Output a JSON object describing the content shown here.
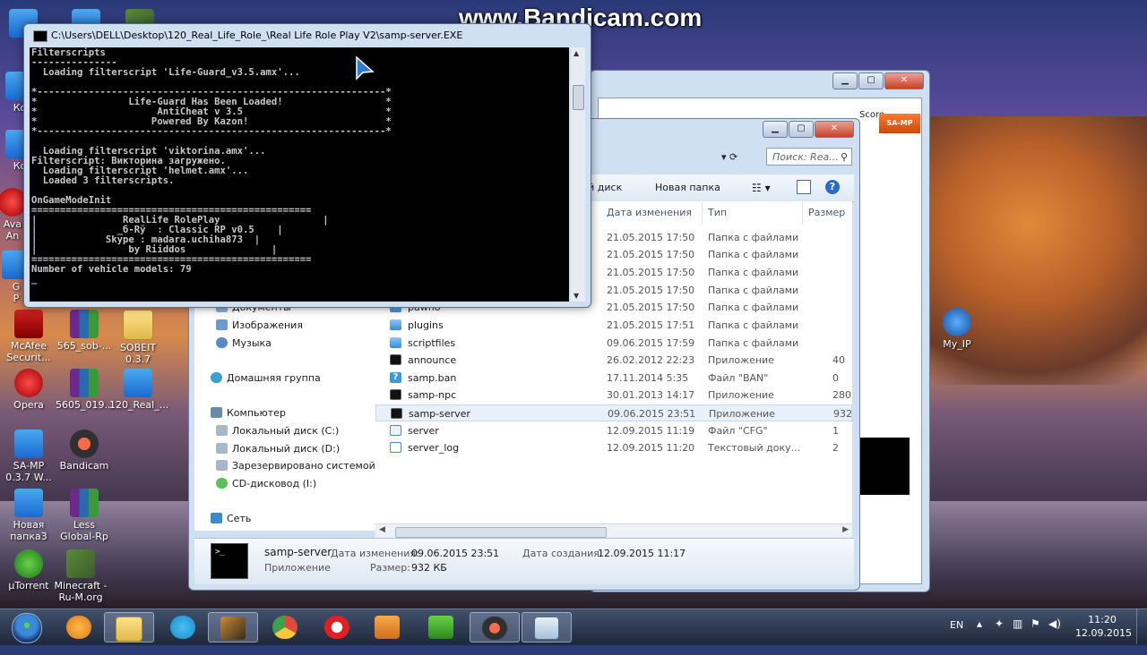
{
  "watermark": "www.Bandicam.com",
  "desktop_icons": [
    {
      "label": "Ко"
    },
    {
      "label": "Ко"
    },
    {
      "label": "Ava\nAn"
    },
    {
      "label": "G\nP"
    },
    {
      "label": "McAfee\nSecurit..."
    },
    {
      "label": "565_sob-..."
    },
    {
      "label": "SOBEIT\n0.3.7"
    },
    {
      "label": "Opera"
    },
    {
      "label": "5605_019..."
    },
    {
      "label": "120_Real_..."
    },
    {
      "label": "SA-MP\n0.3.7 W..."
    },
    {
      "label": "Bandicam"
    },
    {
      "label": "Новая\nпапка3"
    },
    {
      "label": "Less\nGlobal-Rp"
    },
    {
      "label": "µTorrent"
    },
    {
      "label": "Minecraft -\nRu-M.org"
    },
    {
      "label": "My_IP"
    }
  ],
  "console": {
    "title": "C:\\Users\\DELL\\Desktop\\120_Real_Life_Role_\\Real Life Role Play V2\\samp-server.EXE",
    "lines": [
      "Filterscripts",
      "---------------",
      "  Loading filterscript 'Life-Guard_v3.5.amx'...",
      "",
      "*-------------------------------------------------------------*",
      "*                Life-Guard Has Been Loaded!                  *",
      "*                     AntiCheat v 3.5                         *",
      "*                    Powered By Kazon!                        *",
      "*-------------------------------------------------------------*",
      "",
      "  Loading filterscript 'viktorina.amx'...",
      "Filterscript: Викторина загружено.",
      "  Loading filterscript 'helmet.amx'...",
      "  Loaded 3 filterscripts.",
      "",
      "OnGameModeInit",
      "=================================================",
      "|               RealLife RolePlay                  |",
      "|              _б-Rў  : Classic RP v0.5    |",
      "|            Skype : madara.uchiha873  |",
      "|                by Riiddos               |",
      "=================================================",
      "Number of vehicle models: 79",
      "_"
    ]
  },
  "back_window": {
    "score_label": "Score",
    "samp_logo": "SA-MP"
  },
  "explorer": {
    "search_placeholder": "Поиск: Rea...",
    "toolbar": {
      "burn": "ий диск",
      "new_folder": "Новая папка"
    },
    "columns": {
      "date": "Дата изменения",
      "type": "Тип",
      "size": "Размер"
    },
    "nav": [
      {
        "label": "Документы",
        "icon": "documents-icon"
      },
      {
        "label": "Изображения",
        "icon": "images-icon"
      },
      {
        "label": "Музыка",
        "icon": "music-icon"
      },
      {
        "label": "Домашняя группа",
        "icon": "homegroup-icon"
      },
      {
        "label": "Компьютер",
        "icon": "computer-icon"
      },
      {
        "label": "Локальный диск (C:)",
        "icon": "drive-icon"
      },
      {
        "label": "Локальный диск (D:)",
        "icon": "drive-icon"
      },
      {
        "label": "Зарезервировано системой",
        "icon": "drive-icon"
      },
      {
        "label": "CD-дисковод (I:)",
        "icon": "cd-icon"
      },
      {
        "label": "Сеть",
        "icon": "network-icon"
      }
    ],
    "files": [
      {
        "name": "",
        "date": "21.05.2015 17:50",
        "type": "Папка с файлами",
        "size": "",
        "kind": "folder"
      },
      {
        "name": "",
        "date": "21.05.2015 17:50",
        "type": "Папка с файлами",
        "size": "",
        "kind": "folder"
      },
      {
        "name": "",
        "date": "21.05.2015 17:50",
        "type": "Папка с файлами",
        "size": "",
        "kind": "folder"
      },
      {
        "name": "",
        "date": "21.05.2015 17:50",
        "type": "Папка с файлами",
        "size": "",
        "kind": "folder"
      },
      {
        "name": "pawno",
        "date": "21.05.2015 17:50",
        "type": "Папка с файлами",
        "size": "",
        "kind": "folder"
      },
      {
        "name": "plugins",
        "date": "21.05.2015 17:51",
        "type": "Папка с файлами",
        "size": "",
        "kind": "folder"
      },
      {
        "name": "scriptfiles",
        "date": "09.06.2015 17:59",
        "type": "Папка с файлами",
        "size": "",
        "kind": "folder"
      },
      {
        "name": "announce",
        "date": "26.02.2012 22:23",
        "type": "Приложение",
        "size": "40",
        "kind": "app"
      },
      {
        "name": "samp.ban",
        "date": "17.11.2014 5:35",
        "type": "Файл \"BAN\"",
        "size": "0",
        "kind": "unknown"
      },
      {
        "name": "samp-npc",
        "date": "30.01.2013 14:17",
        "type": "Приложение",
        "size": "280",
        "kind": "app"
      },
      {
        "name": "samp-server",
        "date": "09.06.2015 23:51",
        "type": "Приложение",
        "size": "932",
        "kind": "app"
      },
      {
        "name": "server",
        "date": "12.09.2015 11:19",
        "type": "Файл \"CFG\"",
        "size": "1",
        "kind": "cfg"
      },
      {
        "name": "server_log",
        "date": "12.09.2015 11:20",
        "type": "Текстовый доку...",
        "size": "2",
        "kind": "txt"
      }
    ],
    "details": {
      "name": "samp-server",
      "type": "Приложение",
      "modified_label": "Дата изменения:",
      "modified": "09.06.2015 23:51",
      "created_label": "Дата создания:",
      "created": "12.09.2015 11:17",
      "size_label": "Размер:",
      "size": "932 КБ"
    }
  },
  "taskbar": {
    "lang": "EN",
    "time": "11:20",
    "date": "12.09.2015",
    "apps": [
      {
        "name": "explorer-icon"
      },
      {
        "name": "skype-icon"
      },
      {
        "name": "game-icon"
      },
      {
        "name": "chrome-icon"
      },
      {
        "name": "opera-icon"
      },
      {
        "name": "media-player-icon"
      },
      {
        "name": "green-a-icon"
      },
      {
        "name": "bandicam-icon"
      },
      {
        "name": "window-icon"
      }
    ]
  },
  "colors": {
    "taskbar": "#1e2a3c",
    "console_bg": "#000000",
    "console_fg": "#c8c8c8"
  }
}
